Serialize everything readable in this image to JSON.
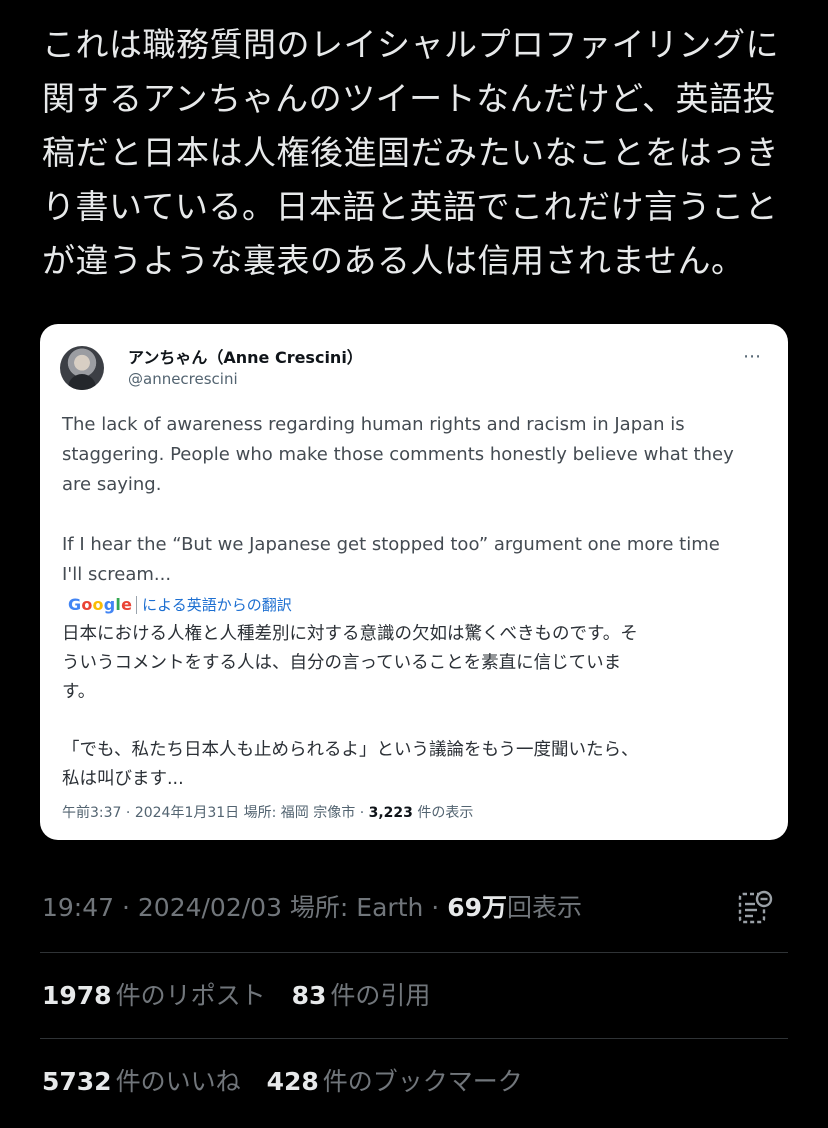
{
  "tweet": {
    "text_lines": [
      "これは職務質問のレイシャルプロファイリングに",
      "関するアンちゃんのツイートなんだけど、英語投",
      "稿だと日本は人権後進国だみたいなことをはっき",
      "り書いている。日本語と英語でこれだけ言うこと",
      "が違うような裏表のある人は信用されません。"
    ]
  },
  "embed": {
    "author_name": "アンちゃん（Anne Crescini）",
    "handle": "@annecrescini",
    "more_icon": "⋯",
    "english_lines": [
      "The lack of awareness regarding human rights and racism in Japan is",
      "staggering. People who make those comments honestly believe what they",
      "are saying.",
      "",
      "If I hear the “But we Japanese get stopped too” argument one more time",
      "I'll scream..."
    ],
    "translate": {
      "logo": [
        "G",
        "o",
        "o",
        "g",
        "l",
        "e"
      ],
      "label": "による英語からの翻訳"
    },
    "japanese_lines": [
      "日本における人権と人種差別に対する意識の欠如は驚くべきものです。そ",
      "ういうコメントをする人は、自分の言っていることを素直に信じていま",
      "す。",
      "",
      "「でも、私たち日本人も止められるよ」という議論をもう一度聞いたら、",
      "私は叫びます..."
    ],
    "meta": {
      "time": "午前3:37",
      "sep1": " · ",
      "date": "2024年1月31日",
      "place": " 場所: 福岡 宗像市",
      "sep2": " · ",
      "views": "3,223",
      "views_label": " 件の表示"
    }
  },
  "post_meta": {
    "time": "19:47",
    "sep1": " · ",
    "date": "2024/02/03",
    "place": " 場所: Earth",
    "sep2": " · ",
    "views": "69万",
    "views_label": "回表示",
    "analytics_icon": "analytics-icon"
  },
  "stats": {
    "reposts": "1978",
    "reposts_label": "件のリポスト",
    "quotes": "83",
    "quotes_label": "件の引用",
    "likes": "5732",
    "likes_label": "件のいいね",
    "bookmarks": "428",
    "bookmarks_label": "件のブックマーク"
  },
  "colors": {
    "background": "#000000",
    "text": "#e7e9ea",
    "secondary": "#71767b",
    "card_bg": "#ffffff",
    "link_blue": "#1d6fd1"
  }
}
